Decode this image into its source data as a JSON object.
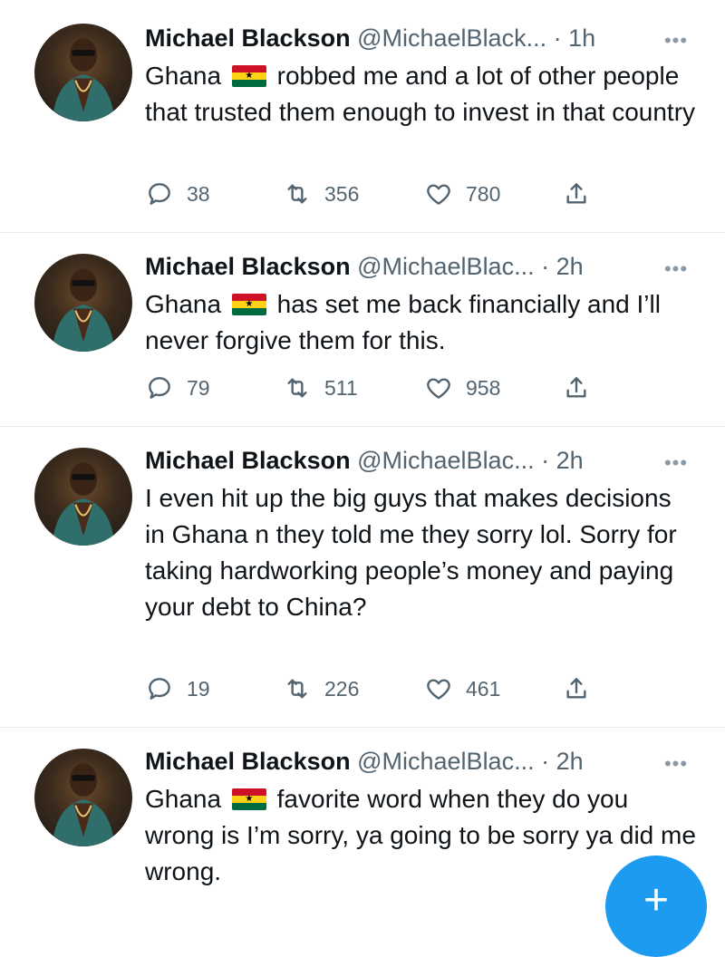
{
  "tweets": [
    {
      "name": "Michael Blackson",
      "handle": "@MichaelBlack...",
      "time": "· 1h",
      "text_before_flag": "Ghana",
      "text_after_flag": "robbed me and a lot of other people that trusted them enough to invest in that country",
      "replies": "38",
      "retweets": "356",
      "likes": "780"
    },
    {
      "name": "Michael Blackson",
      "handle": "@MichaelBlac...",
      "time": "· 2h",
      "text_before_flag": "Ghana",
      "text_after_flag": "has set me back financially and I’ll never forgive them for this.",
      "replies": "79",
      "retweets": "511",
      "likes": "958"
    },
    {
      "name": "Michael Blackson",
      "handle": "@MichaelBlac...",
      "time": "· 2h",
      "text_before_flag": "",
      "text_after_flag": "I even hit up the big guys that makes decisions in Ghana n they told me they sorry lol. Sorry for taking hardworking people’s money and paying your debt to China?",
      "replies": "19",
      "retweets": "226",
      "likes": "461"
    },
    {
      "name": "Michael Blackson",
      "handle": "@MichaelBlac...",
      "time": "· 2h",
      "text_before_flag": "Ghana",
      "text_after_flag": "favorite word when they do you wrong is I’m sorry, ya going to be sorry ya did me wrong.",
      "replies": "",
      "retweets": "",
      "likes": ""
    }
  ],
  "more_glyph": "•••",
  "fab_label": "+",
  "colors": {
    "accent": "#1d9bf0",
    "muted": "#536471",
    "text": "#0f1419"
  }
}
